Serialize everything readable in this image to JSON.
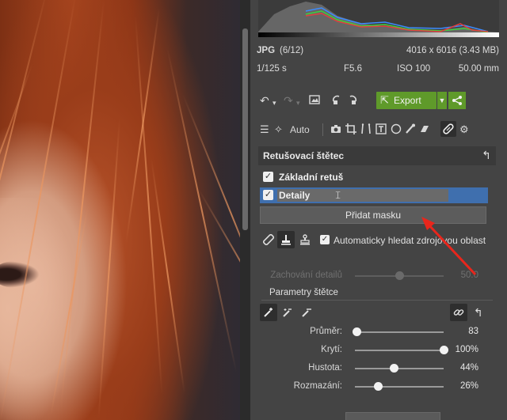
{
  "colors": {
    "panel_bg": "#444444",
    "section_bg": "#3a3a3a",
    "accent_green": "#5f9a2a",
    "selection_blue": "#3f6fae",
    "annotation_arrow": "#e8261c"
  },
  "file_info": {
    "format": "JPG",
    "index": "(6/12)",
    "dimensions": "4016 x 6016 (3.43 MB)",
    "shutter": "1/125 s",
    "aperture": "F5.6",
    "iso": "ISO 100",
    "focal": "50.00 mm"
  },
  "toolbar": {
    "undo_icon": "undo-icon",
    "redo_icon": "redo-icon",
    "export_label": "Export",
    "export_icon": "export-icon",
    "share_icon": "share-icon"
  },
  "tools": {
    "auto_label": "Auto"
  },
  "retouch": {
    "title": "Retušovací štětec",
    "masks": [
      {
        "label": "Základní retuš",
        "checked": true
      },
      {
        "label": "Detaily",
        "checked": true,
        "selected": true
      }
    ],
    "add_mask_label": "Přidat masku",
    "auto_source_label": "Automaticky hledat zdrojovou oblast",
    "auto_source_checked": true,
    "detail_slider": {
      "label": "Zachování detailů",
      "value": "50.0",
      "level": 0.5,
      "disabled": true
    }
  },
  "brush_params": {
    "title": "Parametry štětce",
    "sliders": [
      {
        "label": "Průměr:",
        "value": "83",
        "level": 0.02
      },
      {
        "label": "Krytí:",
        "value": "100%",
        "level": 1.0
      },
      {
        "label": "Hustota:",
        "value": "44%",
        "level": 0.44
      },
      {
        "label": "Rozmazání:",
        "value": "26%",
        "level": 0.26
      }
    ]
  }
}
